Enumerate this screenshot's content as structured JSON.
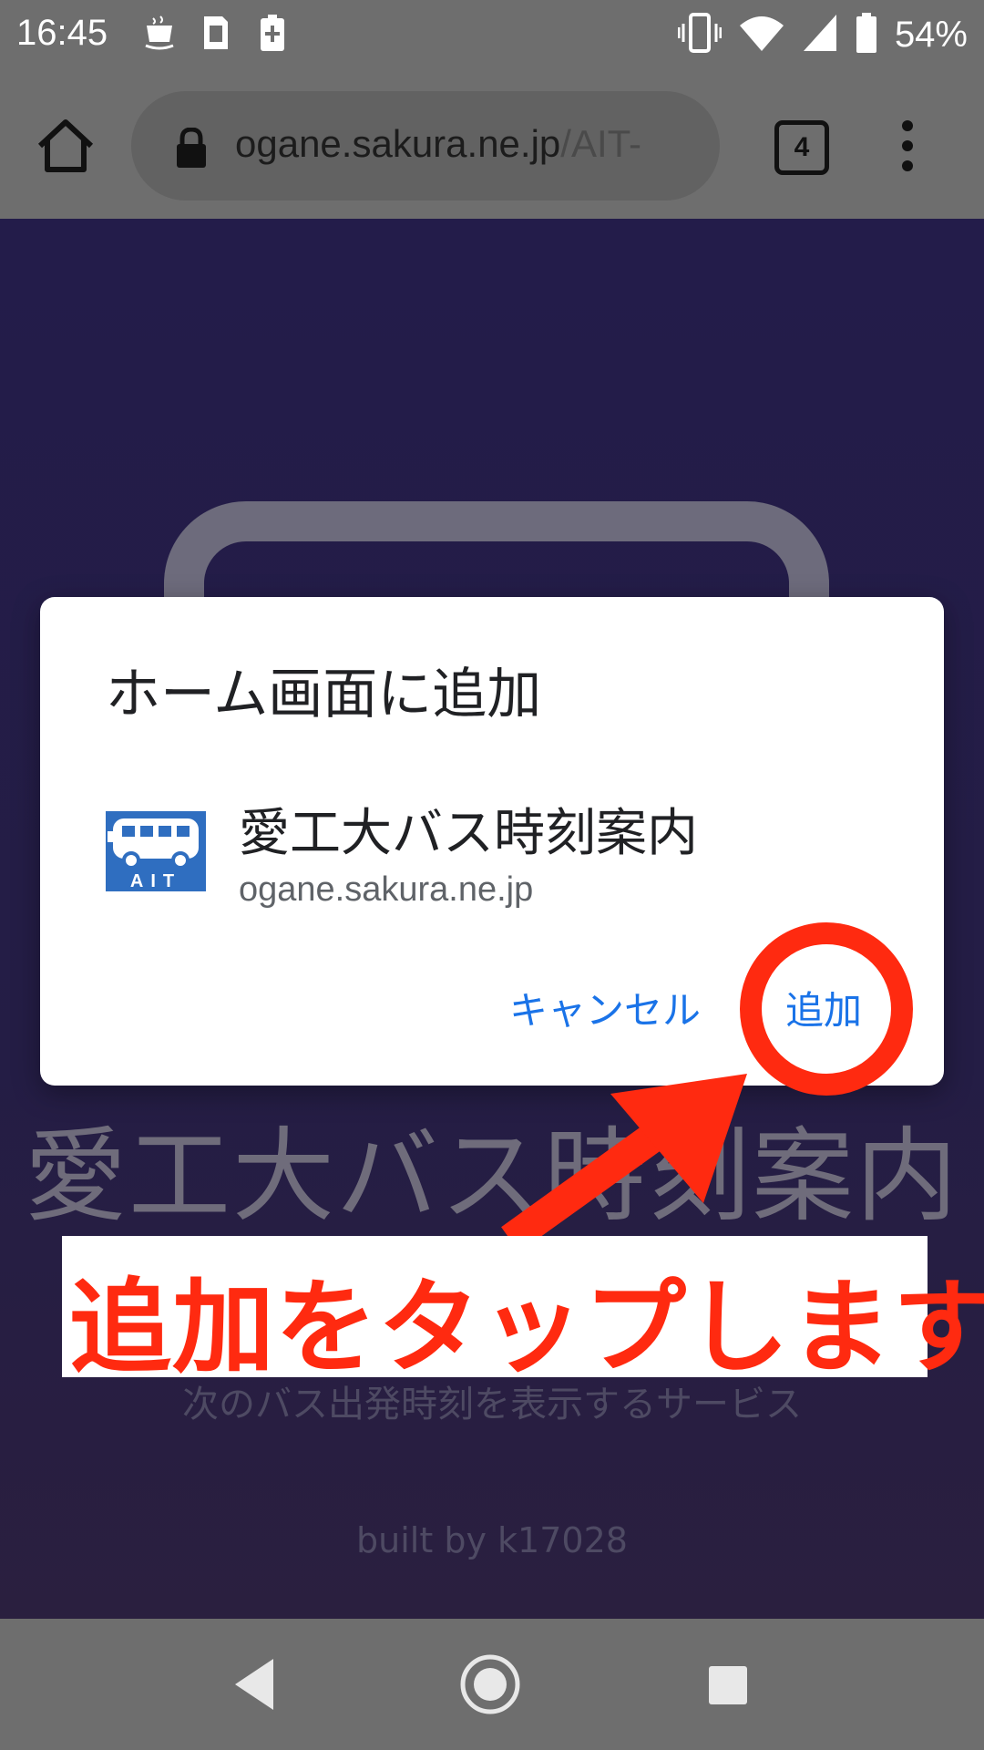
{
  "status_bar": {
    "time": "16:45",
    "left_icons": [
      "steam-cup-icon",
      "sim-card-icon",
      "battery-charging-icon"
    ],
    "right_icons": [
      "vibrate-icon",
      "wifi-icon",
      "signal-icon",
      "battery-icon"
    ],
    "battery_percent": "54%"
  },
  "toolbar": {
    "url_host": "ogane.sakura.ne.jp",
    "url_path": "/AIT-",
    "tab_count": "4"
  },
  "page": {
    "title": "愛工大バス時刻案内",
    "subtitle": "次のバス出発時刻を表示するサービス",
    "credit": "built by k17028"
  },
  "dialog": {
    "title": "ホーム画面に追加",
    "app_name": "愛工大バス時刻案内",
    "app_url": "ogane.sakura.ne.jp",
    "app_icon_text": "AIT",
    "cancel_label": "キャンセル",
    "add_label": "追加"
  },
  "annotation": {
    "caption": "追加をタップします",
    "color": "#ff2a10"
  },
  "nav_bar": {
    "icons": [
      "back-icon",
      "home-icon",
      "recents-icon"
    ]
  }
}
